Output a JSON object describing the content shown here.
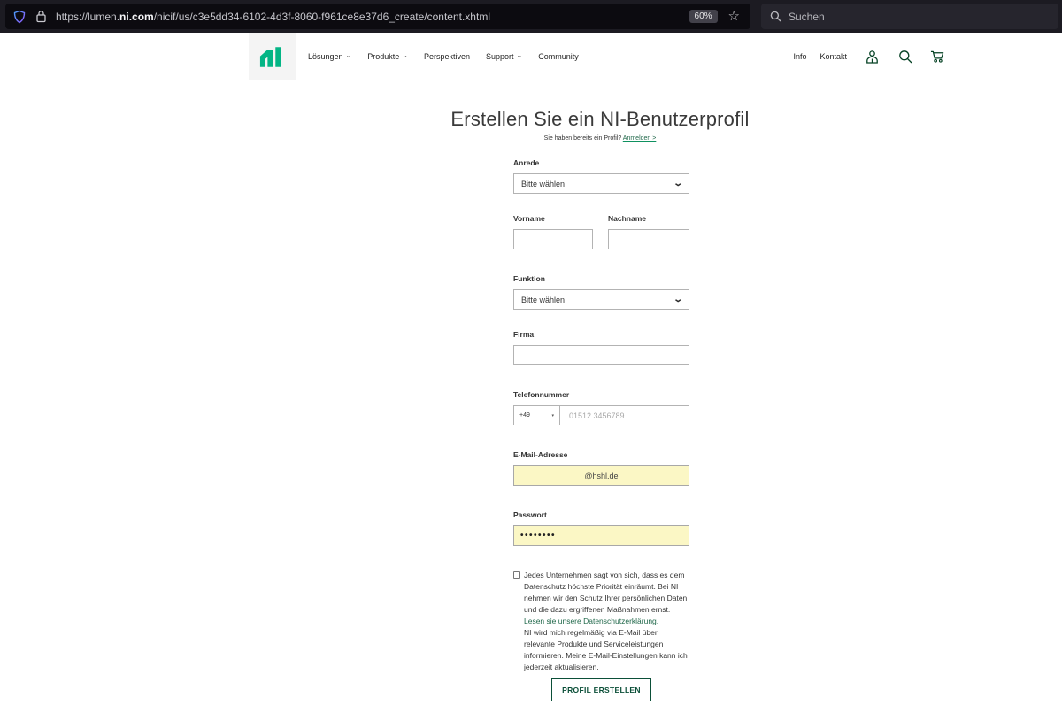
{
  "browser": {
    "url_prefix": "https://lumen.",
    "url_domain": "ni.com",
    "url_path": "/nicif/us/c3e5dd34-6102-4d3f-8060-f961ce8e37d6_create/content.xhtml",
    "zoom_badge": "60%",
    "search_placeholder": "Suchen"
  },
  "header": {
    "nav": [
      {
        "label": "Lösungen"
      },
      {
        "label": "Produkte"
      },
      {
        "label": "Perspektiven"
      },
      {
        "label": "Support"
      },
      {
        "label": "Community"
      }
    ],
    "utility": {
      "info": "Info",
      "kontakt": "Kontakt"
    }
  },
  "main": {
    "title": "Erstellen Sie ein NI-Benutzerprofil",
    "subtitle_text": "Sie haben bereits ein Profil?",
    "subtitle_link": "Anmelden >",
    "form": {
      "anrede": {
        "label": "Anrede",
        "value": "Bitte wählen"
      },
      "vorname_label": "Vorname",
      "nachname_label": "Nachname",
      "funktion": {
        "label": "Funktion",
        "value": "Bitte wählen"
      },
      "firma_label": "Firma",
      "telefon": {
        "label": "Telefonnummer",
        "country_code": "+49",
        "placeholder": "01512 3456789"
      },
      "email": {
        "label": "E-Mail-Adresse",
        "value": "@hshl.de"
      },
      "passwort": {
        "label": "Passwort",
        "value": "••••••••"
      },
      "privacy": {
        "text_1": "Jedes Unternehmen sagt von sich, dass es dem Datenschutz höchste Priorität einräumt. Bei NI nehmen wir den Schutz Ihrer persönlichen Daten und die dazu ergriffenen Maßnahmen ernst. ",
        "link": "Lesen sie unsere Datenschutzerklärung.",
        "text_2": "NI wird mich regelmäßig via E-Mail über relevante Produkte und Serviceleistungen informieren. Meine E-Mail-Einstellungen kann ich jederzeit aktualisieren."
      },
      "submit_label": "PROFIL ERSTELLEN"
    }
  },
  "colors": {
    "logo_green": "#03b585",
    "brand_dark_green": "#044123",
    "button_green": "#0b4f38",
    "autofill_yellow": "#fbf7c5"
  }
}
